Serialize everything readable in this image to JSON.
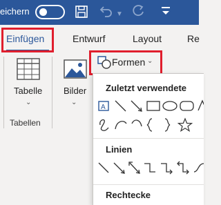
{
  "titlebar": {
    "autosave_text": "eichern",
    "colors": {
      "bg": "#2b579a",
      "fg": "#ffffff",
      "dim": "#8da6cc"
    },
    "icons": [
      "toggle-off-icon",
      "save-icon",
      "undo-icon",
      "undo-dropdown-icon",
      "redo-icon",
      "customize-qa-icon"
    ]
  },
  "tabs": {
    "insert": "Einfügen",
    "design": "Entwurf",
    "layout": "Layout",
    "references": "Re"
  },
  "ribbon": {
    "tables": {
      "button_label": "Tabelle",
      "group_label": "Tabellen",
      "icon": "table-icon"
    },
    "pictures": {
      "button_label": "Bilder",
      "icon": "picture-icon"
    },
    "shapes": {
      "button_label": "Formen",
      "icon": "shapes-icon"
    }
  },
  "shapes_menu": {
    "recent_title": "Zuletzt verwendete",
    "lines_title": "Linien",
    "rectangles_title": "Rechtecke",
    "recent_icons": [
      "text-box-icon",
      "line-icon",
      "arrow-icon",
      "rectangle-icon",
      "oval-icon",
      "rounded-rectangle-icon",
      "triangle-icon",
      "freeform-icon",
      "curve-icon",
      "arc-icon",
      "left-brace-icon",
      "right-brace-icon",
      "star-icon"
    ],
    "lines_icons": [
      "line-icon",
      "arrow-icon",
      "double-arrow-icon",
      "elbow-connector-icon",
      "elbow-arrow-connector-icon",
      "elbow-double-arrow-connector-icon",
      "curved-connector-icon"
    ]
  },
  "highlight_color": "#e01e2d"
}
